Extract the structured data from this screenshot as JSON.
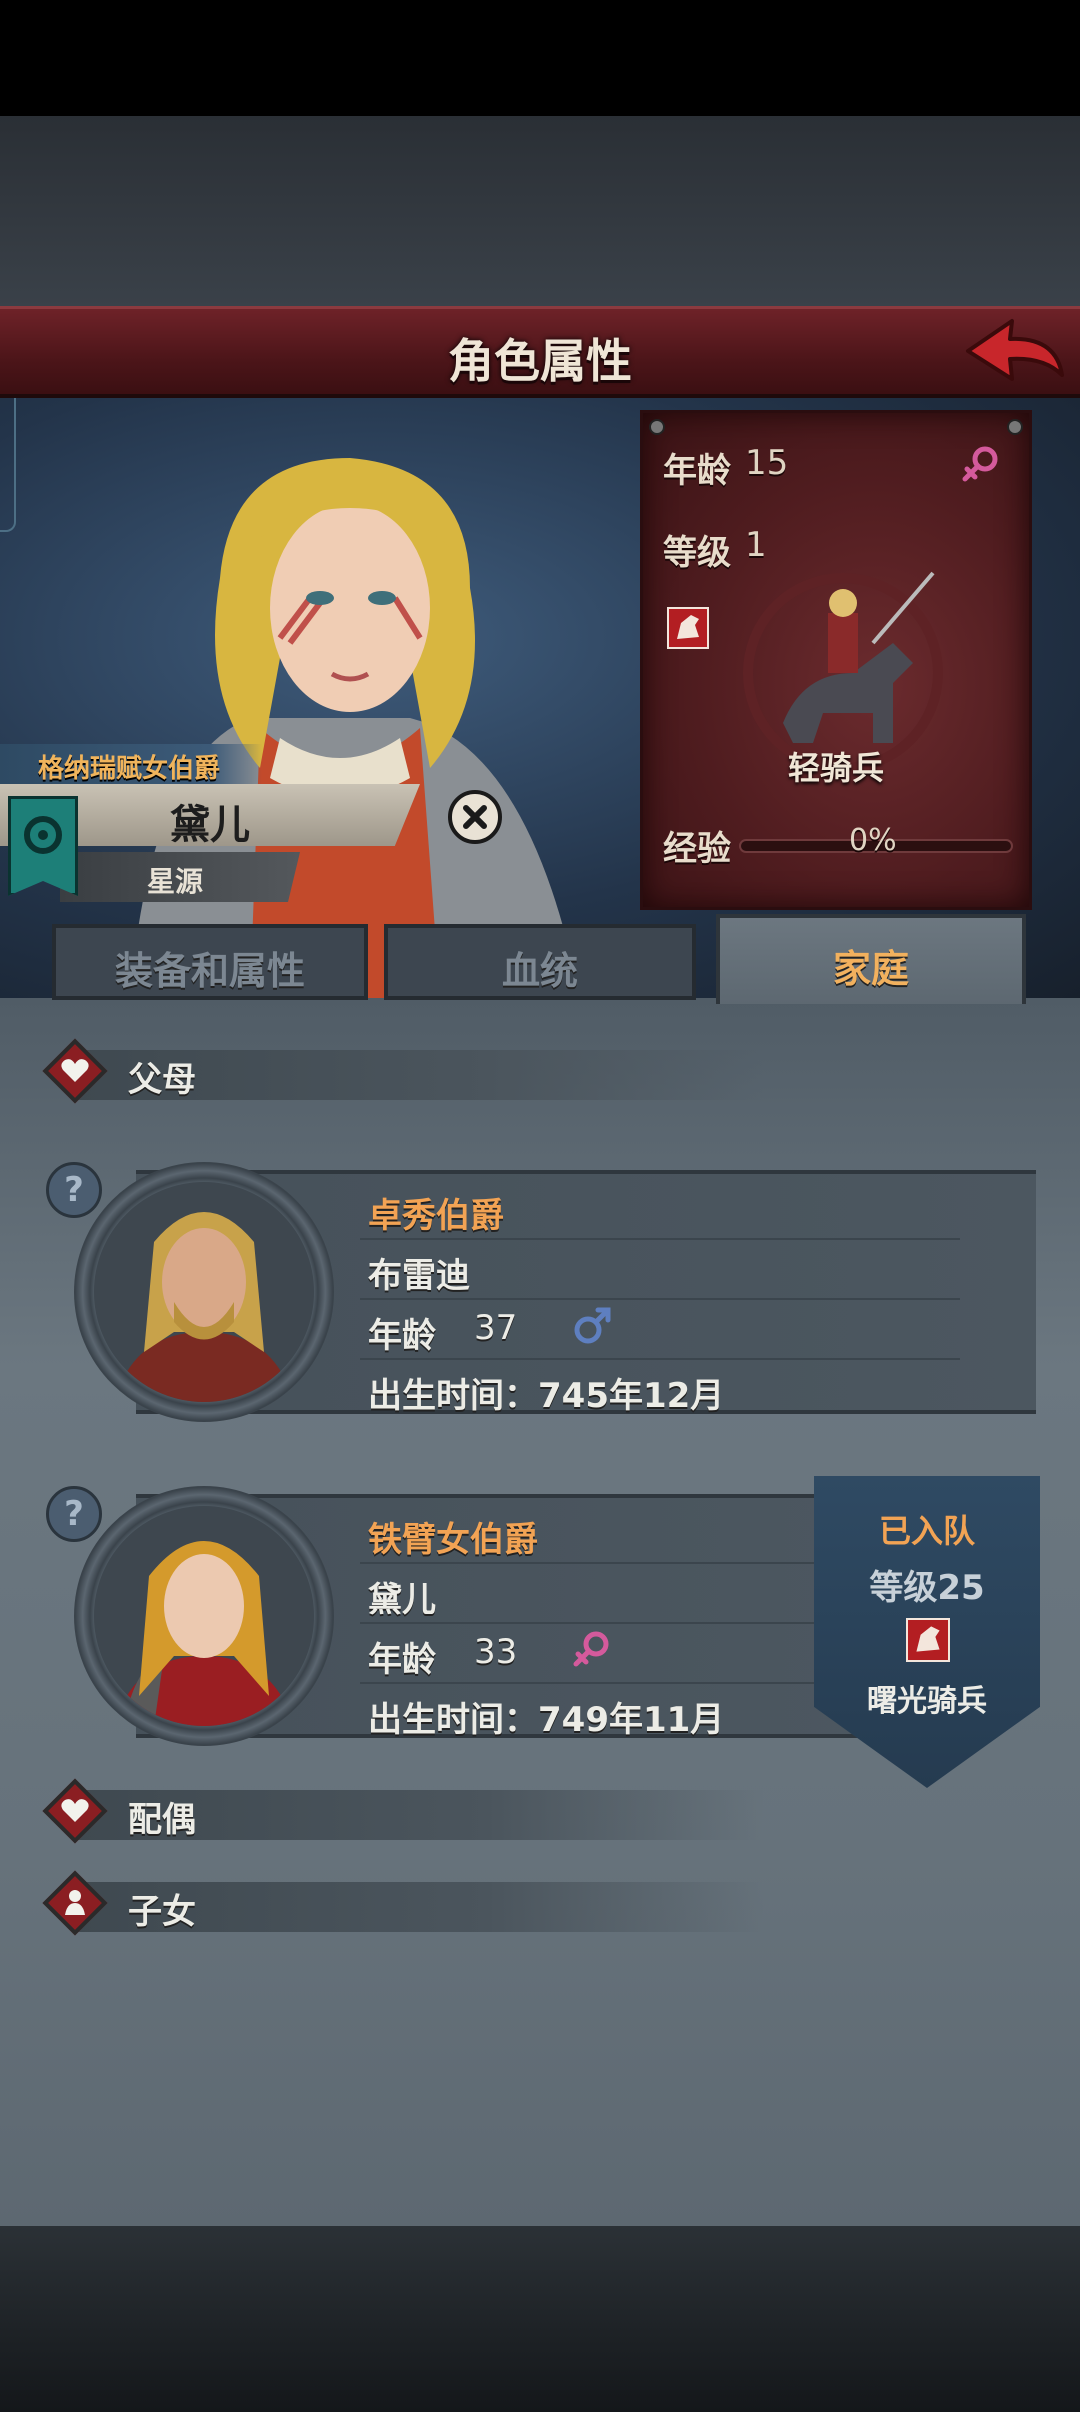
{
  "header": {
    "title": "角色属性"
  },
  "character": {
    "title": "格纳瑞赋女伯爵",
    "name": "黛儿",
    "origin": "星源"
  },
  "stats": {
    "age_label": "年龄",
    "age_value": "15",
    "level_label": "等级",
    "level_value": "1",
    "unit_type": "轻骑兵",
    "exp_label": "经验",
    "exp_value": "0%",
    "exp_fraction": 0
  },
  "tabs": [
    {
      "label": "装备和属性",
      "active": false
    },
    {
      "label": "血统",
      "active": false
    },
    {
      "label": "家庭",
      "active": true
    }
  ],
  "sections": {
    "parents": "父母",
    "spouse": "配偶",
    "children": "子女"
  },
  "parents": [
    {
      "title": "卓秀伯爵",
      "name": "布雷迪",
      "age_label": "年龄",
      "age_value": "37",
      "gender": "male",
      "birth": "出生时间：745年12月"
    },
    {
      "title": "铁臂女伯爵",
      "name": "黛儿",
      "age_label": "年龄",
      "age_value": "33",
      "gender": "female",
      "birth": "出生时间：749年11月"
    }
  ],
  "team_badge": {
    "status": "已入队",
    "level": "等级25",
    "unit": "曙光骑兵"
  },
  "colors": {
    "accent_orange": "#f2a354",
    "title_red": "#4c1519",
    "female_pink": "#d45a9c",
    "male_blue": "#5e7fc0"
  }
}
